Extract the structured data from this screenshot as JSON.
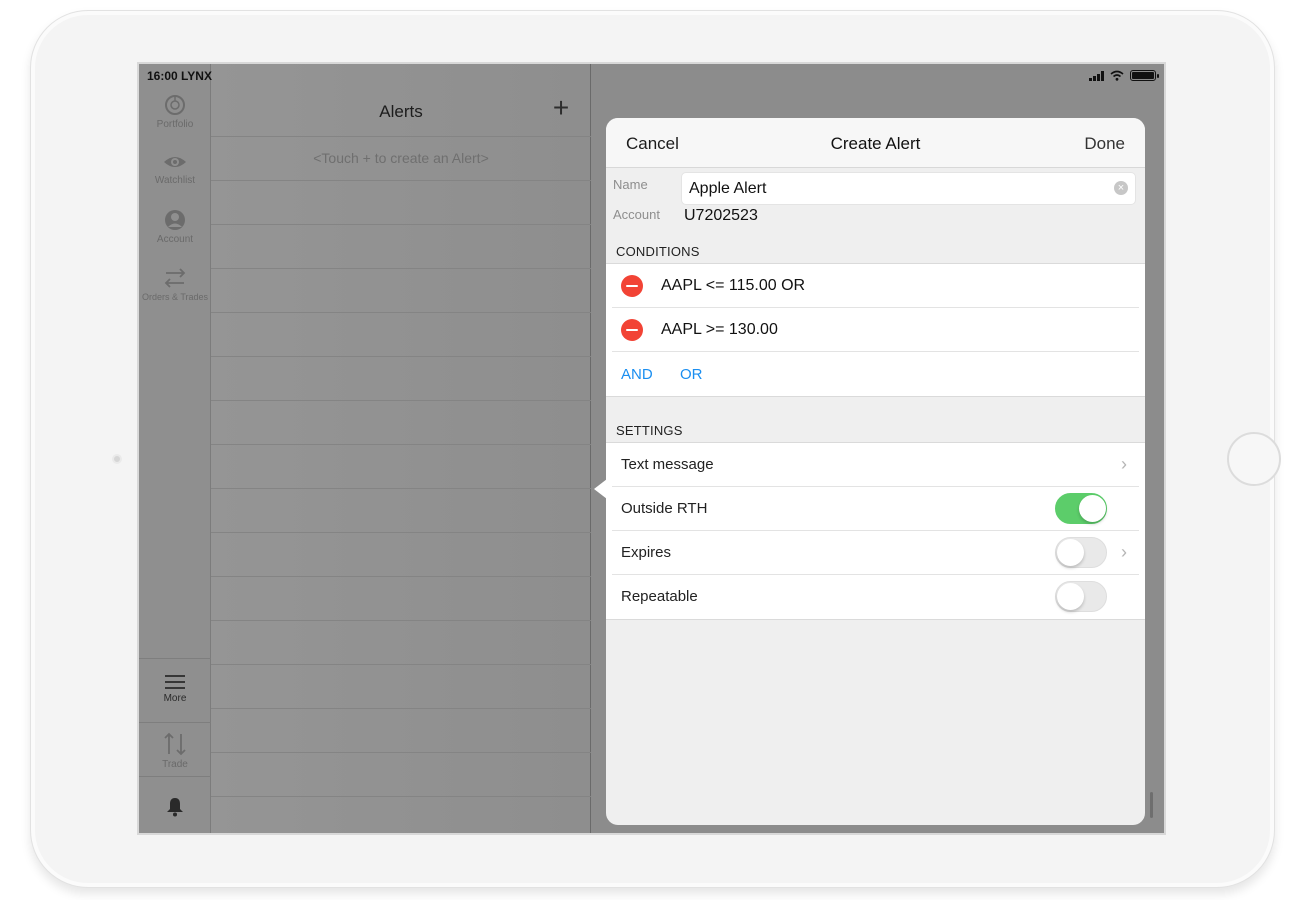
{
  "status_bar": {
    "time": "16:00",
    "carrier": "LYNX"
  },
  "sidebar": {
    "items": [
      {
        "label": "Portfolio",
        "icon": "portfolio-icon"
      },
      {
        "label": "Watchlist",
        "icon": "eye-icon"
      },
      {
        "label": "Account",
        "icon": "person-icon"
      },
      {
        "label": "Orders & Trades",
        "icon": "arrows-icon"
      }
    ],
    "more_label": "More",
    "trade_label": "Trade",
    "bell_icon": "bell-icon"
  },
  "alerts": {
    "title": "Alerts",
    "add_symbol": "+",
    "hint": "<Touch + to create an Alert>"
  },
  "dialog": {
    "cancel_label": "Cancel",
    "title": "Create Alert",
    "done_label": "Done",
    "name_label": "Name",
    "name_value": "Apple Alert",
    "account_label": "Account",
    "account_value": "U7202523",
    "conditions_header": "CONDITIONS",
    "conditions": [
      {
        "text": "AAPL <= 115.00 OR"
      },
      {
        "text": "AAPL >= 130.00"
      }
    ],
    "and_label": "AND",
    "or_label": "OR",
    "settings_header": "SETTINGS",
    "settings": [
      {
        "label": "Text message",
        "has_chevron": true,
        "toggle": null
      },
      {
        "label": "Outside RTH",
        "has_chevron": false,
        "toggle": true
      },
      {
        "label": "Expires",
        "has_chevron": true,
        "toggle": false
      },
      {
        "label": "Repeatable",
        "has_chevron": false,
        "toggle": false
      }
    ]
  },
  "colors": {
    "accent_blue": "#1a8ef0",
    "delete_red": "#f24335",
    "toggle_green": "#5ccd6a"
  }
}
